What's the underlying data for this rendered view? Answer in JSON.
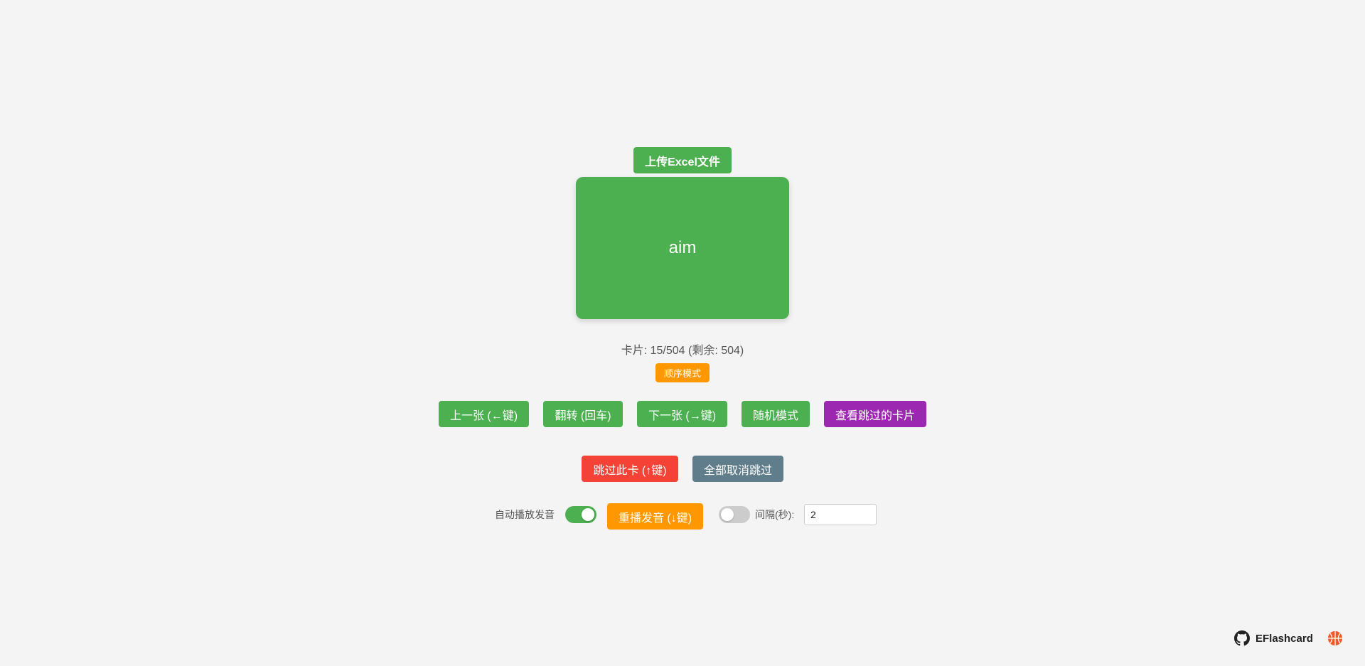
{
  "upload": {
    "label": "上传Excel文件"
  },
  "card": {
    "text": "aim"
  },
  "status": {
    "counter": "卡片: 15/504 (剩余: 504)",
    "mode_badge": "顺序模式"
  },
  "controls": {
    "prev": "上一张 (←键)",
    "flip": "翻转 (回车)",
    "next": "下一张 (→键)",
    "random": "随机模式",
    "view_skipped": "查看跳过的卡片",
    "skip": "跳过此卡 (↑键)",
    "unskip_all": "全部取消跳过"
  },
  "audio": {
    "auto_play_label": "自动播放发音",
    "auto_play_on": true,
    "replay": "重播发音 (↓键)",
    "auto_advance_on": false,
    "interval_label": "间隔(秒):",
    "interval_value": "2"
  },
  "footer": {
    "brand": "EFlashcard",
    "icons": [
      "github-icon",
      "basketball-icon"
    ]
  },
  "colors": {
    "primary": "#4caf50",
    "orange": "#ff9800",
    "purple": "#9c27b0",
    "red": "#f44336",
    "slate": "#607d8b",
    "background": "#f4f4f4"
  }
}
